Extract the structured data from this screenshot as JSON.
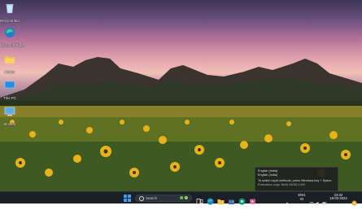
{
  "desktop": {
    "icons": [
      {
        "label": "Recycle Bin",
        "icon": "recycle-bin-icon"
      },
      {
        "label": "Microsoft Edge",
        "icon": "edge-icon"
      },
      {
        "label": "Folder",
        "icon": "folder-icon"
      },
      {
        "label": "This PC",
        "icon": "this-pc-icon"
      },
      {
        "label": "Monitor",
        "icon": "monitor-icon"
      }
    ]
  },
  "ime_popup": {
    "line1": "English (India)",
    "line2": "English (India)",
    "line3": "To switch input methods, press Windows key + Space.",
    "watermark_a": "Insider Preview",
    "watermark_b": "Evaluation copy. Build 26080.1400"
  },
  "taskbar": {
    "search_placeholder": "Search",
    "apps": [
      "task-view-icon",
      "edge-icon",
      "file-explorer-icon",
      "store-icon",
      "edge-dev-icon",
      "media-icon"
    ],
    "tray": {
      "lang_top": "ENG",
      "lang_bottom": "IN",
      "time": "23:22",
      "date": "18-03-2024"
    }
  },
  "colors": {
    "taskbar_bg": "#1b1f26",
    "accent": "#3aa0f3"
  }
}
